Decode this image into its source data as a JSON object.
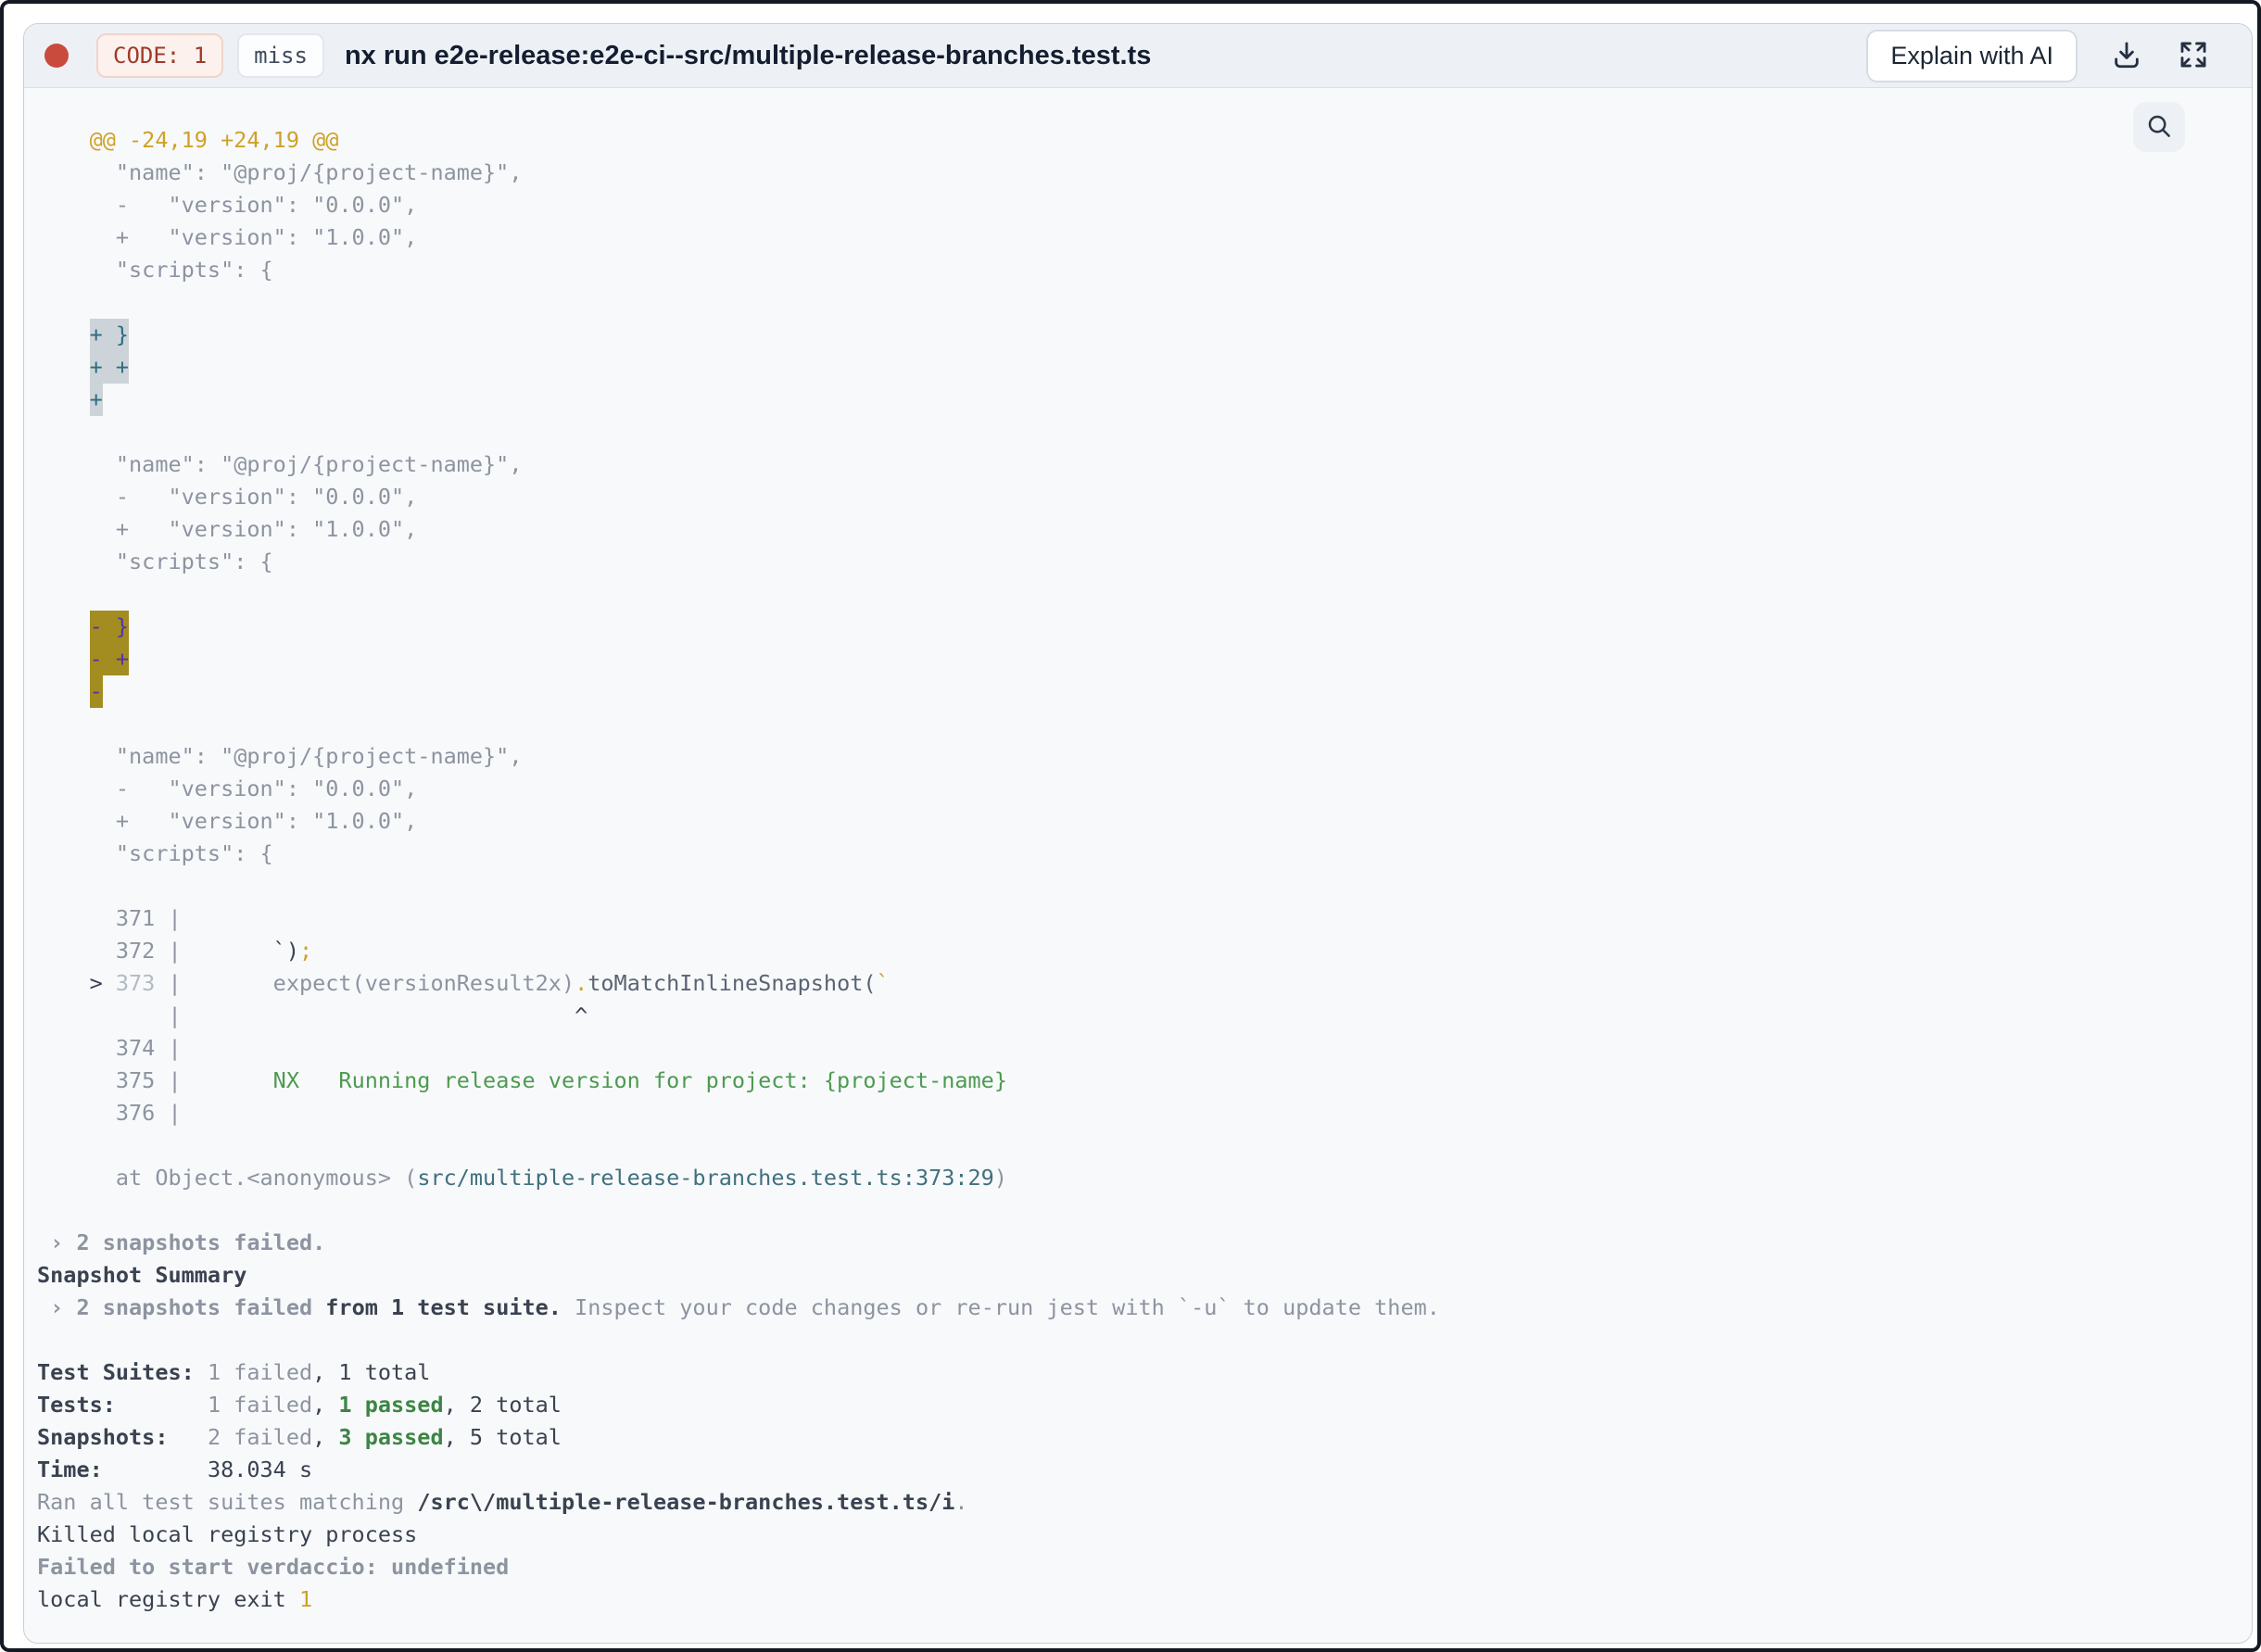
{
  "header": {
    "exit_code_badge": "CODE: 1",
    "cache_status_badge": "miss",
    "title": "nx run e2e-release:e2e-ci--src/multiple-release-branches.test.ts",
    "explain_button_label": "Explain with AI",
    "icons": [
      "download-icon",
      "fullscreen-icon"
    ]
  },
  "content_toolbar": {
    "icons": [
      "search-icon"
    ]
  },
  "colors": {
    "accent_red": "#c84b3e",
    "diff_header_gold": "#cfa127",
    "snapshot_green": "#4d9a50",
    "pass_green": "#3c8544",
    "path_teal": "#40707e",
    "add_highlight_bg": "#ccd4da",
    "add_highlight_text": "#2e6c7e",
    "del_highlight_bg": "#a38c20",
    "del_highlight_text": "#5335ab"
  },
  "terminal": {
    "lines": [
      [
        {
          "t": "    @@ -24,19 +24,19 @@",
          "s": "gold"
        }
      ],
      [
        {
          "t": "      \"name\": \"@proj/{project-name}\",",
          "s": "gray"
        }
      ],
      [
        {
          "t": "      -   \"version\": \"0.0.0\",",
          "s": "gray"
        }
      ],
      [
        {
          "t": "      +   \"version\": \"1.0.0\",",
          "s": "gray"
        }
      ],
      [
        {
          "t": "      \"scripts\": {",
          "s": "gray"
        }
      ],
      [],
      [
        {
          "t": "    ",
          "s": "gray"
        },
        {
          "t": "+ }",
          "s": "addHl"
        }
      ],
      [
        {
          "t": "    ",
          "s": "gray"
        },
        {
          "t": "+ +",
          "s": "addHl"
        }
      ],
      [
        {
          "t": "    ",
          "s": "gray"
        },
        {
          "t": "+",
          "s": "addHl"
        }
      ],
      [],
      [
        {
          "t": "      \"name\": \"@proj/{project-name}\",",
          "s": "gray"
        }
      ],
      [
        {
          "t": "      -   \"version\": \"0.0.0\",",
          "s": "gray"
        }
      ],
      [
        {
          "t": "      +   \"version\": \"1.0.0\",",
          "s": "gray"
        }
      ],
      [
        {
          "t": "      \"scripts\": {",
          "s": "gray"
        }
      ],
      [],
      [
        {
          "t": "    ",
          "s": "gray"
        },
        {
          "t": "- }",
          "s": "delHl"
        }
      ],
      [
        {
          "t": "    ",
          "s": "gray"
        },
        {
          "t": "- +",
          "s": "delHl"
        }
      ],
      [
        {
          "t": "    ",
          "s": "gray"
        },
        {
          "t": "-",
          "s": "delHl"
        }
      ],
      [],
      [
        {
          "t": "      \"name\": \"@proj/{project-name}\",",
          "s": "gray"
        }
      ],
      [
        {
          "t": "      -   \"version\": \"0.0.0\",",
          "s": "gray"
        }
      ],
      [
        {
          "t": "      +   \"version\": \"1.0.0\",",
          "s": "gray"
        }
      ],
      [
        {
          "t": "      \"scripts\": {",
          "s": "gray"
        }
      ],
      [],
      [
        {
          "t": "      371 |",
          "s": "gray"
        }
      ],
      [
        {
          "t": "      372 |",
          "s": "gray"
        },
        {
          "t": "       `)",
          "s": "dark"
        },
        {
          "t": ";",
          "s": "gold"
        }
      ],
      [
        {
          "t": "    > ",
          "s": "dark"
        },
        {
          "t": "373",
          "s": "dim"
        },
        {
          "t": " |",
          "s": "gray"
        },
        {
          "t": "       expect(versionResult2x)",
          "s": "gray"
        },
        {
          "t": ".",
          "s": "gold"
        },
        {
          "t": "toMatchInlineSnapshot(",
          "s": "method"
        },
        {
          "t": "`",
          "s": "gold"
        }
      ],
      [
        {
          "t": "          |",
          "s": "gray"
        },
        {
          "t": "                              ^",
          "s": "dark"
        }
      ],
      [
        {
          "t": "      374 |",
          "s": "gray"
        }
      ],
      [
        {
          "t": "      375 |",
          "s": "gray"
        },
        {
          "t": "       NX   Running release version for project: {project-name}",
          "s": "green"
        }
      ],
      [
        {
          "t": "      376 |",
          "s": "gray"
        }
      ],
      [],
      [
        {
          "t": "      at Object.<anonymous> (",
          "s": "gray"
        },
        {
          "t": "src/multiple-release-branches.test.ts:373:29",
          "s": "teal"
        },
        {
          "t": ")",
          "s": "gray"
        }
      ],
      [],
      [
        {
          "t": " › 2 snapshots failed.",
          "s": "grayBold"
        }
      ],
      [
        {
          "t": "Snapshot Summary",
          "s": "darkBold"
        }
      ],
      [
        {
          "t": " › 2 snapshots failed",
          "s": "grayBold"
        },
        {
          "t": " from 1 test suite.",
          "s": "darkBold"
        },
        {
          "t": " Inspect your code changes or re-run jest with `-u` to update them.",
          "s": "gray"
        }
      ],
      [],
      [
        {
          "t": "Test Suites: ",
          "s": "darkBold"
        },
        {
          "t": "1 failed",
          "s": "gray"
        },
        {
          "t": ", 1 total",
          "s": "dark"
        }
      ],
      [
        {
          "t": "Tests:       ",
          "s": "darkBold"
        },
        {
          "t": "1 failed",
          "s": "gray"
        },
        {
          "t": ", ",
          "s": "dark"
        },
        {
          "t": "1 passed",
          "s": "greenBold"
        },
        {
          "t": ", 2 total",
          "s": "dark"
        }
      ],
      [
        {
          "t": "Snapshots:   ",
          "s": "darkBold"
        },
        {
          "t": "2 failed",
          "s": "gray"
        },
        {
          "t": ", ",
          "s": "dark"
        },
        {
          "t": "3 passed",
          "s": "greenBold"
        },
        {
          "t": ", 5 total",
          "s": "dark"
        }
      ],
      [
        {
          "t": "Time:        ",
          "s": "darkBold"
        },
        {
          "t": "38.034 s",
          "s": "dark"
        }
      ],
      [
        {
          "t": "Ran all test suites matching ",
          "s": "gray"
        },
        {
          "t": "/src\\/multiple-release-branches.test.ts/i",
          "s": "darkBold"
        },
        {
          "t": ".",
          "s": "gray"
        }
      ],
      [
        {
          "t": "Killed local registry process",
          "s": "dark"
        }
      ],
      [
        {
          "t": "Failed to start verdaccio: undefined",
          "s": "grayBold"
        }
      ],
      [
        {
          "t": "local registry exit ",
          "s": "dark"
        },
        {
          "t": "1",
          "s": "gold"
        }
      ]
    ]
  }
}
